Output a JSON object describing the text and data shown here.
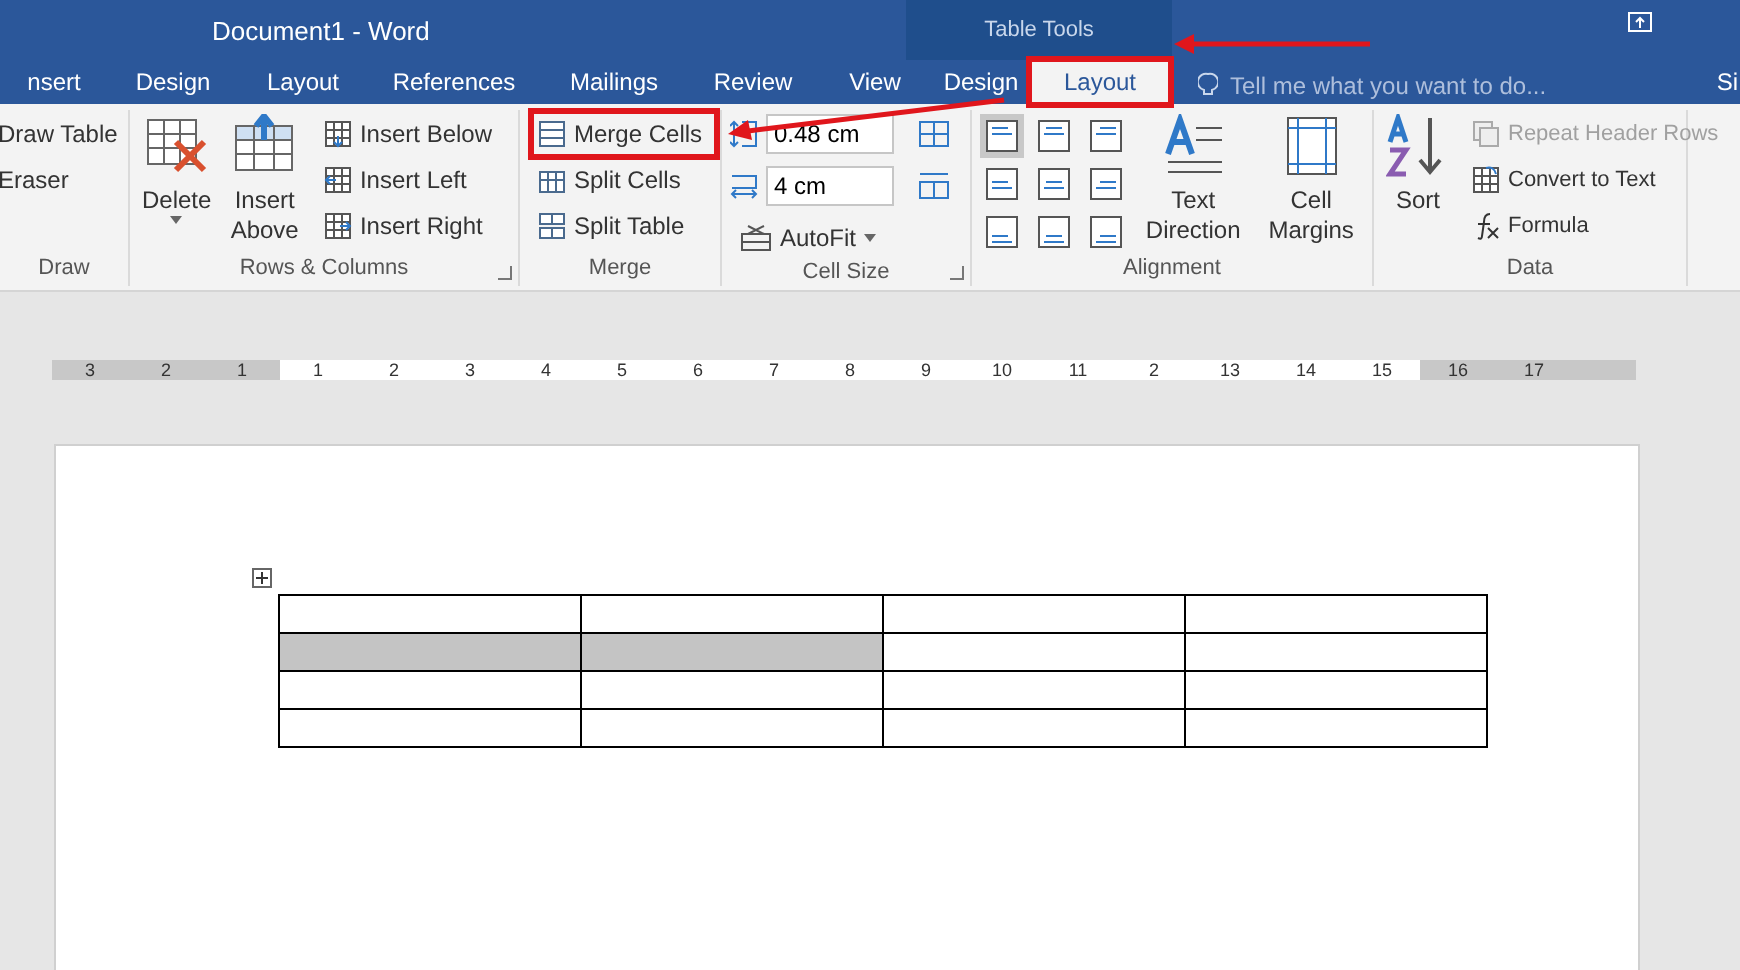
{
  "window": {
    "title": "Document1 - Word",
    "context_header": "Table Tools"
  },
  "tabs": [
    {
      "label": "nsert",
      "selected": false,
      "highlighted": false
    },
    {
      "label": "Design",
      "selected": false,
      "highlighted": false
    },
    {
      "label": "Layout",
      "selected": false,
      "highlighted": false
    },
    {
      "label": "References",
      "selected": false,
      "highlighted": false
    },
    {
      "label": "Mailings",
      "selected": false,
      "highlighted": false
    },
    {
      "label": "Review",
      "selected": false,
      "highlighted": false
    },
    {
      "label": "View",
      "selected": false,
      "highlighted": false
    },
    {
      "label": "Design",
      "selected": false,
      "highlighted": false
    },
    {
      "label": "Layout",
      "selected": true,
      "highlighted": true
    }
  ],
  "tell_me": {
    "placeholder": "Tell me what you want to do..."
  },
  "sign_in": "Si",
  "ribbon": {
    "groups": [
      {
        "title": "Draw",
        "items": [
          {
            "kind": "stack",
            "items": [
              {
                "label": "Draw Table",
                "highlighted": false,
                "disabled": false
              },
              {
                "label": "Eraser",
                "highlighted": false,
                "disabled": false
              }
            ]
          }
        ]
      },
      {
        "title": "Rows & Columns",
        "items": [
          {
            "kind": "large",
            "label": "Delete"
          },
          {
            "kind": "large",
            "label": "Insert Above"
          },
          {
            "kind": "stack",
            "items": [
              {
                "label": "Insert Below",
                "highlighted": false,
                "disabled": false
              },
              {
                "label": "Insert Left",
                "highlighted": false,
                "disabled": false
              },
              {
                "label": "Insert Right",
                "highlighted": false,
                "disabled": false
              }
            ]
          }
        ]
      },
      {
        "title": "Merge",
        "items": [
          {
            "kind": "stack",
            "items": [
              {
                "label": "Merge Cells",
                "highlighted": true,
                "disabled": false
              },
              {
                "label": "Split Cells",
                "highlighted": false,
                "disabled": false
              },
              {
                "label": "Split Table",
                "highlighted": false,
                "disabled": false
              }
            ]
          }
        ]
      },
      {
        "title": "Cell Size",
        "items": [
          {
            "kind": "cellsize",
            "height": "0.48 cm",
            "width": "4 cm",
            "autofit": "AutoFit"
          }
        ]
      },
      {
        "title": "Alignment",
        "items": [
          {
            "kind": "align",
            "cells": [
              {
                "selected": true
              },
              {
                "selected": false
              },
              {
                "selected": false
              },
              {
                "selected": false
              },
              {
                "selected": false
              },
              {
                "selected": false
              },
              {
                "selected": false
              },
              {
                "selected": false
              },
              {
                "selected": false
              }
            ]
          },
          {
            "kind": "large",
            "label": "Text Direction"
          },
          {
            "kind": "large",
            "label": "Cell Margins"
          }
        ]
      },
      {
        "title": "Data",
        "items": [
          {
            "kind": "large",
            "label": "Sort"
          },
          {
            "kind": "stack",
            "items": [
              {
                "label": "Repeat Header Rows",
                "highlighted": false,
                "disabled": true
              },
              {
                "label": "Convert to Text",
                "highlighted": false,
                "disabled": false
              },
              {
                "label": "Formula",
                "highlighted": false,
                "disabled": false
              }
            ]
          }
        ]
      }
    ]
  },
  "ruler": [
    {
      "label": "3",
      "shaded": true
    },
    {
      "label": "2",
      "shaded": true
    },
    {
      "label": "1",
      "shaded": true
    },
    {
      "label": "1",
      "shaded": false
    },
    {
      "label": "2",
      "shaded": false
    },
    {
      "label": "3",
      "shaded": false
    },
    {
      "label": "4",
      "shaded": false
    },
    {
      "label": "5",
      "shaded": false
    },
    {
      "label": "6",
      "shaded": false
    },
    {
      "label": "7",
      "shaded": false
    },
    {
      "label": "8",
      "shaded": false
    },
    {
      "label": "9",
      "shaded": false
    },
    {
      "label": "10",
      "shaded": false
    },
    {
      "label": "11",
      "shaded": false
    },
    {
      "label": "2",
      "shaded": false
    },
    {
      "label": "13",
      "shaded": false
    },
    {
      "label": "14",
      "shaded": false
    },
    {
      "label": "15",
      "shaded": false
    },
    {
      "label": "16",
      "shaded": true
    },
    {
      "label": "17",
      "shaded": true
    }
  ],
  "table": {
    "rows": [
      [
        {
          "selected": false
        },
        {
          "selected": false
        },
        {
          "selected": false
        },
        {
          "selected": false
        }
      ],
      [
        {
          "selected": true
        },
        {
          "selected": true
        },
        {
          "selected": false
        },
        {
          "selected": false
        }
      ],
      [
        {
          "selected": false
        },
        {
          "selected": false
        },
        {
          "selected": false
        },
        {
          "selected": false
        }
      ],
      [
        {
          "selected": false
        },
        {
          "selected": false
        },
        {
          "selected": false
        },
        {
          "selected": false
        }
      ]
    ]
  }
}
